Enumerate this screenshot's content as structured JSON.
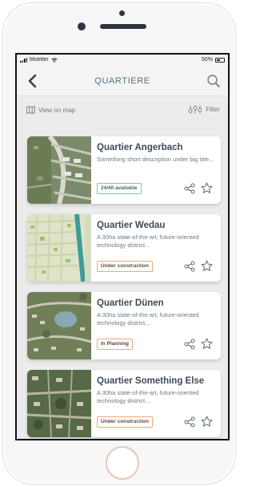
{
  "statusbar": {
    "carrier": "Moetter",
    "battery": "50%"
  },
  "header": {
    "title": "QUARTIERE"
  },
  "toolbar": {
    "view_on_map": "View on map",
    "filter": "Filter"
  },
  "cards": [
    {
      "title": "Quartier Angerbach",
      "description": "Something short description under big title...",
      "status": "24/40 available",
      "status_color": "green"
    },
    {
      "title": "Quartier Wedau",
      "description": "A 30ha state-of-the-art, future-oriented technology district...",
      "status": "Under construction",
      "status_color": "orange"
    },
    {
      "title": "Quartier Dünen",
      "description": "A 30ha state-of-the-art, future-oriented technology district...",
      "status": "In Planning",
      "status_color": "orange"
    },
    {
      "title": "Quartier Something Else",
      "description": "A 30ha state-of-the-art, future-oriented technology district...",
      "status": "Under construction",
      "status_color": "orange"
    }
  ],
  "colors": {
    "accent_text": "#5b6f7c",
    "green_badge": "#8cc49b",
    "orange_badge": "#f0a57c"
  }
}
